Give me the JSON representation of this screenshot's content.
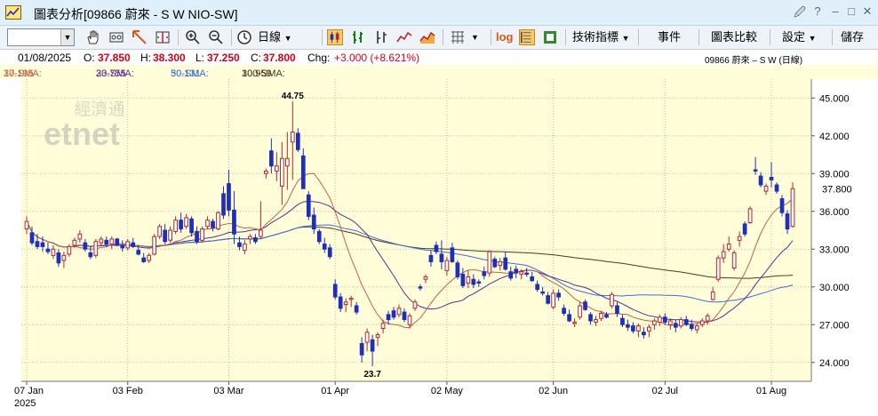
{
  "window": {
    "title": "圖表分析[09866 蔚來 - S W NIO-SW]",
    "controls": {
      "attach": "🖉",
      "help": "?",
      "minimize": "–",
      "maximize": "□",
      "close": "✕"
    }
  },
  "toolbar": {
    "combo_value": "",
    "period": "日線",
    "log_label": "log",
    "indicators": "技術指標",
    "events": "事件",
    "compare": "圖表比較",
    "settings": "設定",
    "save": "儲存",
    "icons": [
      "hand-icon",
      "crosshair-icon",
      "draw-line-icon",
      "fit-icon",
      "zoom-in-icon",
      "zoom-out-icon",
      "clock-icon",
      "candlestick-icon",
      "ohlc-bar-icon",
      "hlc-bar-icon",
      "line-chart-icon",
      "area-chart-icon",
      "grid-icon",
      "scale-icon",
      "export-icon"
    ]
  },
  "info": {
    "date": "01/08/2025",
    "open_label": "O:",
    "open": "37.850",
    "high_label": "H:",
    "high": "38.300",
    "low_label": "L:",
    "low": "37.250",
    "close_label": "C:",
    "close": "37.800",
    "chg_label": "Chg:",
    "chg": "+3.000 (+8.621%)",
    "symbol": "09866  蔚來 – S W (日線)"
  },
  "sma": {
    "sma10_label": "10-SMA:",
    "sma10": "37.195",
    "sma20_label": "20-SMA:",
    "sma20": "33.755",
    "sma50_label": "50-SMA:",
    "sma50": "30.131",
    "sma100_label": "100-SMA:",
    "sma100": "30.959"
  },
  "watermark": {
    "line1": "經濟通",
    "line2": "etnet"
  },
  "colors": {
    "up": "#b3262d",
    "down": "#1f2fb8",
    "bg": "#fffed8",
    "sma10": "#c0614b",
    "sma20": "#5c2d91",
    "sma50": "#3a6fd9",
    "sma100": "#4a3a22",
    "chg": "#d0021b"
  },
  "chart_data": {
    "type": "candlestick",
    "y_ticks": [
      "45.000",
      "42.000",
      "39.000",
      "36.000",
      "33.000",
      "30.000",
      "27.000",
      "24.000"
    ],
    "ylim": [
      22.5,
      46.5
    ],
    "x_ticks": [
      "07 Jan",
      "03 Feb",
      "03 Mar",
      "01 Apr",
      "02 May",
      "02 Jun",
      "02 Jul",
      "01 Aug"
    ],
    "x_tick_index": [
      0,
      19,
      38,
      58,
      79,
      99,
      120,
      140
    ],
    "year_label": "2025",
    "last_price_label": "37.800",
    "high_annotation": "44.75",
    "low_annotation": "23.7",
    "candles": [
      [
        34.6,
        35.6,
        34.2,
        35.2
      ],
      [
        34.3,
        34.8,
        33.3,
        33.5
      ],
      [
        33.6,
        34.2,
        33.0,
        33.2
      ],
      [
        33.5,
        34.0,
        32.8,
        33.2
      ],
      [
        33.0,
        33.5,
        32.6,
        32.8
      ],
      [
        32.5,
        33.3,
        32.2,
        33.0
      ],
      [
        32.7,
        33.0,
        31.6,
        31.9
      ],
      [
        32.1,
        32.8,
        31.5,
        32.5
      ],
      [
        32.6,
        33.4,
        32.4,
        33.2
      ],
      [
        33.3,
        33.9,
        33.1,
        33.7
      ],
      [
        33.8,
        34.5,
        33.5,
        34.2
      ],
      [
        33.5,
        33.8,
        32.8,
        33.0
      ],
      [
        32.7,
        33.2,
        32.2,
        32.4
      ],
      [
        32.5,
        33.8,
        32.3,
        33.6
      ],
      [
        33.5,
        34.0,
        33.3,
        33.8
      ],
      [
        33.7,
        34.0,
        33.2,
        33.4
      ],
      [
        33.4,
        34.0,
        33.0,
        33.8
      ],
      [
        33.8,
        33.9,
        33.2,
        33.3
      ],
      [
        33.3,
        33.7,
        32.8,
        33.1
      ],
      [
        33.1,
        33.8,
        32.9,
        33.6
      ],
      [
        33.5,
        33.9,
        33.1,
        33.2
      ],
      [
        32.9,
        33.3,
        32.5,
        32.6
      ],
      [
        32.3,
        32.7,
        31.9,
        32.0
      ],
      [
        32.1,
        32.7,
        31.9,
        32.5
      ],
      [
        32.6,
        34.2,
        32.5,
        34.0
      ],
      [
        34.0,
        35.0,
        33.8,
        34.8
      ],
      [
        34.5,
        35.0,
        33.4,
        33.6
      ],
      [
        33.7,
        34.8,
        33.5,
        34.5
      ],
      [
        34.4,
        35.6,
        34.2,
        35.3
      ],
      [
        35.3,
        35.9,
        34.3,
        34.6
      ],
      [
        34.8,
        35.8,
        34.6,
        35.5
      ],
      [
        35.4,
        35.6,
        34.0,
        34.3
      ],
      [
        34.4,
        34.8,
        33.4,
        33.6
      ],
      [
        33.7,
        34.8,
        33.5,
        34.6
      ],
      [
        34.8,
        35.6,
        34.6,
        35.3
      ],
      [
        35.2,
        35.4,
        34.4,
        34.7
      ],
      [
        34.6,
        36.0,
        34.5,
        35.9
      ],
      [
        37.4,
        38.0,
        35.4,
        35.7
      ],
      [
        38.2,
        39.3,
        35.6,
        36.1
      ],
      [
        36.1,
        37.6,
        33.4,
        34.2
      ],
      [
        33.5,
        34.0,
        32.9,
        33.2
      ],
      [
        32.9,
        33.7,
        32.6,
        33.4
      ],
      [
        33.8,
        34.2,
        33.4,
        34.0
      ],
      [
        33.9,
        34.2,
        33.4,
        33.6
      ],
      [
        34.0,
        36.8,
        33.8,
        34.5
      ],
      [
        39.0,
        39.4,
        38.6,
        39.2
      ],
      [
        40.8,
        41.8,
        39.0,
        39.6
      ],
      [
        39.2,
        40.7,
        38.4,
        39.6
      ],
      [
        38.0,
        41.5,
        36.5,
        40.2
      ],
      [
        39.6,
        42.3,
        37.7,
        40.2
      ],
      [
        41.5,
        44.75,
        38.5,
        42.3
      ],
      [
        42.2,
        42.6,
        40.7,
        40.9
      ],
      [
        40.4,
        41.0,
        37.8,
        37.8
      ],
      [
        37.3,
        37.6,
        35.3,
        35.6
      ],
      [
        35.7,
        36.3,
        34.2,
        34.6
      ],
      [
        34.4,
        34.6,
        33.4,
        33.6
      ],
      [
        33.4,
        33.9,
        32.7,
        33.0
      ],
      [
        33.1,
        33.4,
        32.2,
        32.4
      ],
      [
        30.2,
        30.6,
        29.0,
        29.2
      ],
      [
        29.2,
        29.5,
        28.0,
        28.3
      ],
      [
        28.6,
        29.1,
        28.0,
        28.8
      ],
      [
        29.0,
        29.3,
        28.4,
        29.1
      ],
      [
        28.5,
        28.8,
        27.8,
        28.0
      ],
      [
        25.5,
        26.0,
        24.0,
        24.6
      ],
      [
        25.6,
        26.7,
        24.9,
        26.4
      ],
      [
        25.8,
        26.2,
        23.7,
        24.9
      ],
      [
        26.0,
        26.4,
        25.3,
        26.2
      ],
      [
        26.7,
        27.4,
        26.3,
        27.1
      ],
      [
        27.8,
        28.1,
        27.0,
        27.4
      ],
      [
        28.1,
        28.4,
        27.4,
        27.6
      ],
      [
        27.8,
        28.6,
        27.6,
        28.3
      ],
      [
        28.0,
        28.3,
        27.2,
        27.4
      ],
      [
        27.0,
        27.9,
        26.7,
        27.7
      ],
      [
        28.3,
        29.0,
        28.1,
        28.8
      ],
      [
        30.0,
        30.2,
        29.7,
        29.9
      ],
      [
        30.6,
        31.0,
        30.3,
        30.8
      ],
      [
        32.5,
        32.9,
        31.6,
        32.0
      ],
      [
        33.3,
        33.6,
        32.6,
        32.8
      ],
      [
        32.6,
        33.7,
        31.4,
        32.0
      ],
      [
        31.3,
        32.4,
        30.9,
        32.1
      ],
      [
        33.1,
        33.5,
        31.9,
        32.0
      ],
      [
        31.9,
        32.1,
        30.6,
        30.8
      ],
      [
        31.0,
        31.5,
        29.9,
        30.1
      ],
      [
        30.3,
        31.3,
        29.9,
        30.8
      ],
      [
        30.6,
        31.0,
        29.9,
        30.2
      ],
      [
        30.4,
        30.6,
        30.0,
        30.3
      ],
      [
        31.2,
        31.6,
        30.6,
        30.9
      ],
      [
        31.1,
        32.9,
        30.8,
        32.8
      ],
      [
        32.2,
        32.4,
        31.5,
        31.6
      ],
      [
        31.7,
        32.3,
        31.3,
        32.0
      ],
      [
        32.3,
        32.8,
        31.3,
        31.4
      ],
      [
        31.2,
        31.6,
        30.5,
        30.7
      ],
      [
        31.4,
        31.7,
        30.7,
        31.1
      ],
      [
        31.0,
        31.4,
        30.6,
        31.2
      ],
      [
        31.1,
        31.5,
        30.8,
        31.0
      ],
      [
        30.8,
        31.2,
        30.4,
        30.5
      ],
      [
        30.2,
        30.5,
        29.6,
        29.8
      ],
      [
        29.6,
        30.0,
        29.3,
        29.5
      ],
      [
        29.3,
        29.6,
        28.6,
        28.7
      ],
      [
        28.4,
        29.8,
        28.2,
        29.5
      ],
      [
        29.5,
        29.8,
        28.9,
        29.2
      ],
      [
        28.3,
        28.6,
        27.7,
        27.9
      ],
      [
        27.8,
        28.2,
        27.2,
        27.3
      ],
      [
        27.1,
        27.5,
        26.8,
        27.2
      ],
      [
        27.6,
        28.8,
        27.4,
        28.5
      ],
      [
        28.8,
        29.0,
        28.1,
        28.2
      ],
      [
        27.8,
        28.0,
        27.0,
        27.3
      ],
      [
        27.2,
        27.7,
        26.9,
        27.4
      ],
      [
        27.5,
        28.1,
        27.3,
        27.9
      ],
      [
        27.8,
        28.0,
        27.5,
        27.6
      ],
      [
        28.5,
        29.6,
        28.3,
        29.4
      ],
      [
        28.5,
        28.8,
        27.6,
        27.9
      ],
      [
        27.5,
        27.8,
        26.8,
        27.0
      ],
      [
        27.0,
        27.4,
        26.5,
        26.8
      ],
      [
        26.9,
        27.2,
        26.3,
        26.5
      ],
      [
        26.5,
        27.1,
        26.0,
        26.9
      ],
      [
        26.4,
        26.8,
        25.9,
        26.2
      ],
      [
        26.5,
        27.0,
        26.0,
        26.8
      ],
      [
        27.0,
        27.5,
        26.6,
        27.3
      ],
      [
        27.2,
        27.8,
        26.9,
        27.6
      ],
      [
        27.6,
        27.9,
        27.0,
        27.2
      ],
      [
        27.0,
        27.5,
        26.6,
        27.3
      ],
      [
        27.1,
        27.4,
        26.4,
        26.8
      ],
      [
        26.9,
        27.6,
        26.7,
        27.4
      ],
      [
        27.4,
        27.7,
        26.9,
        27.0
      ],
      [
        27.0,
        27.4,
        26.5,
        26.7
      ],
      [
        26.6,
        27.1,
        26.3,
        26.9
      ],
      [
        27.0,
        27.5,
        26.8,
        27.3
      ],
      [
        27.3,
        27.9,
        27.0,
        27.7
      ],
      [
        29.0,
        30.0,
        28.9,
        29.6
      ],
      [
        30.6,
        32.5,
        30.4,
        32.3
      ],
      [
        32.3,
        33.4,
        31.9,
        32.8
      ],
      [
        33.0,
        34.0,
        32.8,
        33.4
      ],
      [
        31.5,
        32.9,
        31.3,
        32.7
      ],
      [
        33.7,
        34.4,
        33.2,
        34.0
      ],
      [
        35.0,
        35.2,
        34.0,
        34.2
      ],
      [
        35.1,
        36.4,
        35.0,
        36.2
      ],
      [
        39.3,
        40.3,
        38.9,
        39.2
      ],
      [
        38.8,
        39.1,
        37.9,
        38.1
      ],
      [
        37.6,
        38.2,
        37.3,
        38.0
      ],
      [
        38.7,
        39.9,
        37.9,
        38.5
      ],
      [
        38.1,
        38.3,
        37.4,
        37.6
      ],
      [
        37.0,
        37.3,
        35.6,
        35.9
      ],
      [
        35.8,
        36.1,
        34.2,
        34.6
      ],
      [
        34.8,
        38.3,
        34.7,
        37.8
      ]
    ]
  }
}
